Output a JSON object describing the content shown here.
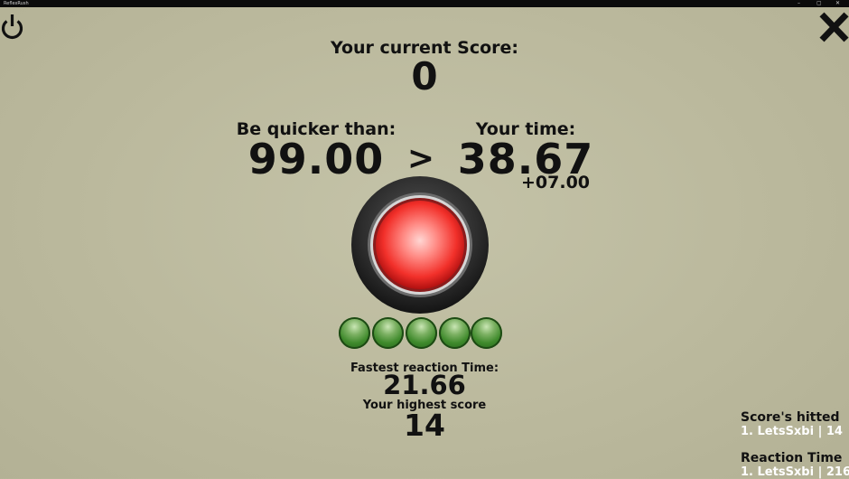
{
  "window": {
    "title": "ReflexRush",
    "controls": [
      "–",
      "▢",
      "✕"
    ]
  },
  "score": {
    "label": "Your current Score:",
    "value": "0"
  },
  "target": {
    "label": "Be quicker than:",
    "value": "99.00"
  },
  "comparison_symbol": ">",
  "your_time": {
    "label": "Your time:",
    "value": "38.67",
    "bonus": "+07.00"
  },
  "reaction_button": {
    "icon": "red-round-button",
    "color": "#ff3a3a"
  },
  "lives": {
    "count": 5,
    "remaining": 5,
    "color": "#3f8a2c"
  },
  "stats": {
    "fastest_label": "Fastest reaction Time:",
    "fastest_value": "21.66",
    "highest_label": "Your highest score",
    "highest_value": "14"
  },
  "leaderboards": {
    "scores_title": "Score's hitted",
    "scores_entry": "1. LetsSxbi | 14",
    "reaction_title": "Reaction Time",
    "reaction_entry": "1. LetsSxbi | 216"
  },
  "icons": {
    "top_left": "power-icon",
    "top_right": "close-icon"
  }
}
